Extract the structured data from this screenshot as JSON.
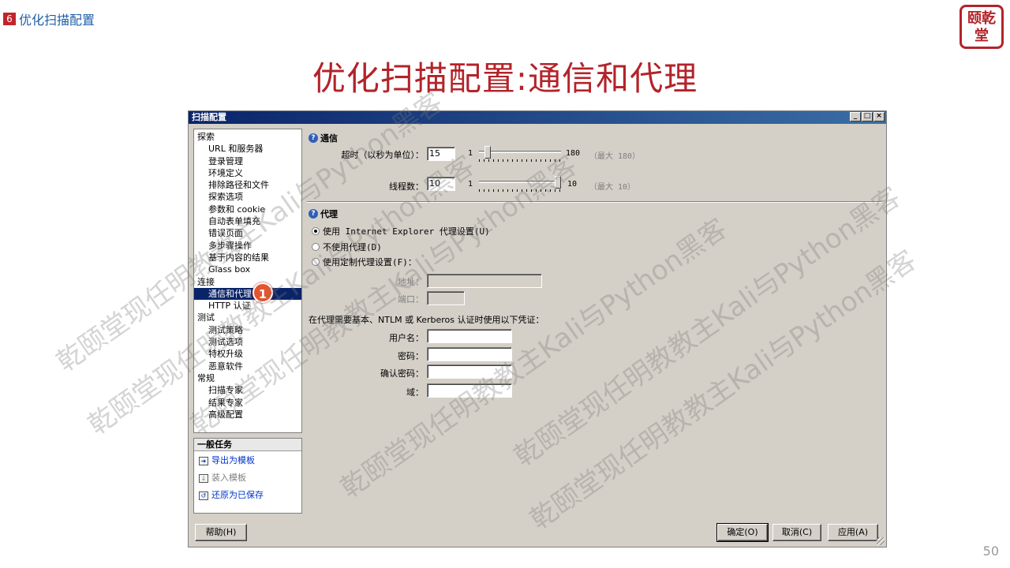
{
  "slide": {
    "section_number": "6",
    "section_label": "优化扫描配置",
    "title": "优化扫描配置:通信和代理",
    "page_number": "50",
    "logo_text": [
      "颐乾",
      "堂"
    ],
    "watermark": "乾颐堂现任明教教主Kali与Python黑客"
  },
  "dialog": {
    "title": "扫描配置",
    "titlebar_buttons": [
      "_",
      "□",
      "×"
    ],
    "nav": [
      {
        "type": "cat",
        "label": "探索"
      },
      {
        "type": "item",
        "label": "URL 和服务器"
      },
      {
        "type": "item",
        "label": "登录管理"
      },
      {
        "type": "item",
        "label": "环境定义"
      },
      {
        "type": "item",
        "label": "排除路径和文件"
      },
      {
        "type": "item",
        "label": "探索选项"
      },
      {
        "type": "item",
        "label": "参数和 cookie"
      },
      {
        "type": "item",
        "label": "自动表单填充"
      },
      {
        "type": "item",
        "label": "错误页面"
      },
      {
        "type": "item",
        "label": "多步骤操作"
      },
      {
        "type": "item",
        "label": "基于内容的结果"
      },
      {
        "type": "item",
        "label": "Glass box"
      },
      {
        "type": "cat",
        "label": "连接"
      },
      {
        "type": "item",
        "label": "通信和代理",
        "selected": true
      },
      {
        "type": "item",
        "label": "HTTP 认证"
      },
      {
        "type": "cat",
        "label": "测试"
      },
      {
        "type": "item",
        "label": "测试策略"
      },
      {
        "type": "item",
        "label": "测试选项"
      },
      {
        "type": "item",
        "label": "特权升级"
      },
      {
        "type": "item",
        "label": "恶意软件"
      },
      {
        "type": "cat",
        "label": "常规"
      },
      {
        "type": "item",
        "label": "扫描专家"
      },
      {
        "type": "item",
        "label": "结果专家"
      },
      {
        "type": "item",
        "label": "高级配置"
      }
    ],
    "tasks": {
      "heading": "一般任务",
      "items": [
        "导出为模板",
        "装入模板",
        "还原为已保存"
      ]
    },
    "comm": {
      "heading": "通信",
      "timeout_label": "超时（以秒为单位）：",
      "timeout_value": "15",
      "timeout_min": "1",
      "timeout_max": "180",
      "timeout_max_note": "（最大 180）",
      "timeout_level": 0.07,
      "threads_label": "线程数：",
      "threads_value": "10",
      "threads_min": "1",
      "threads_max": "10",
      "threads_max_note": "（最大 10）",
      "threads_level": 1.0
    },
    "proxy": {
      "heading": "代理",
      "options": [
        "使用 Internet Explorer 代理设置(U)",
        "不使用代理(D)",
        "使用定制代理设置(F)："
      ],
      "selected_option": 0,
      "address_label": "地址：",
      "address_value": "",
      "port_label": "端口：",
      "port_value": "",
      "cred_text": "在代理需要基本、NTLM 或 Kerberos 认证时使用以下凭证：",
      "username_label": "用户名：",
      "password_label": "密码：",
      "confirm_label": "确认密码：",
      "domain_label": "域："
    },
    "buttons": {
      "help": "帮助(H)",
      "ok": "确定(O)",
      "cancel": "取消(C)",
      "apply": "应用(A)"
    },
    "callout_number": "1"
  }
}
